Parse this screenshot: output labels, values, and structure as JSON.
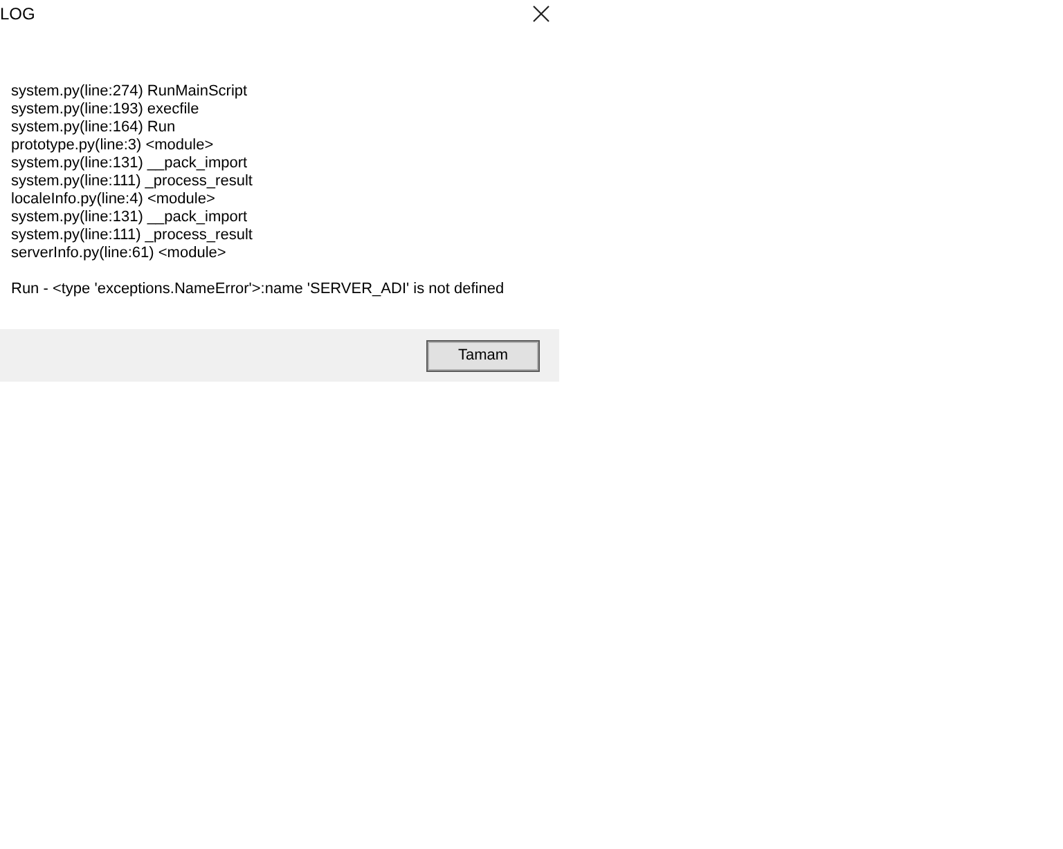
{
  "window": {
    "title": "LOG"
  },
  "traceback": [
    "system.py(line:274) RunMainScript",
    "system.py(line:193) execfile",
    "system.py(line:164) Run",
    "prototype.py(line:3) <module>",
    "system.py(line:131) __pack_import",
    "system.py(line:111) _process_result",
    "localeInfo.py(line:4) <module>",
    "system.py(line:131) __pack_import",
    "system.py(line:111) _process_result",
    "serverInfo.py(line:61) <module>"
  ],
  "error": "Run - <type 'exceptions.NameError'>:name 'SERVER_ADI' is not defined",
  "buttons": [
    {
      "label": "Tamam"
    }
  ]
}
